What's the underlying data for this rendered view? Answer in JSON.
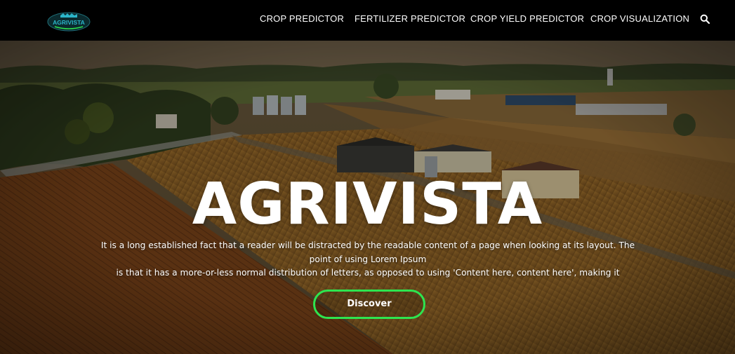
{
  "brand": {
    "logo_text": "AGRIVISTA",
    "accent_color": "#2ee44f",
    "logo_color": "#2bb5c9"
  },
  "nav": {
    "items": [
      {
        "label": "CROP PREDICTOR"
      },
      {
        "label": "FERTILIZER PREDICTOR"
      },
      {
        "label": "CROP YIELD PREDICTOR"
      },
      {
        "label": "CROP VISUALIZATION"
      }
    ],
    "search_icon": "search-icon"
  },
  "hero": {
    "title": "AGRIVISTA",
    "description_line1": "It is a long established fact that a reader will be distracted by the readable content of a page when looking at its layout. The point of using Lorem Ipsum",
    "description_line2": "is that it has a more-or-less normal distribution of letters, as opposed to using 'Content here, content here', making it",
    "button_label": "Discover"
  }
}
